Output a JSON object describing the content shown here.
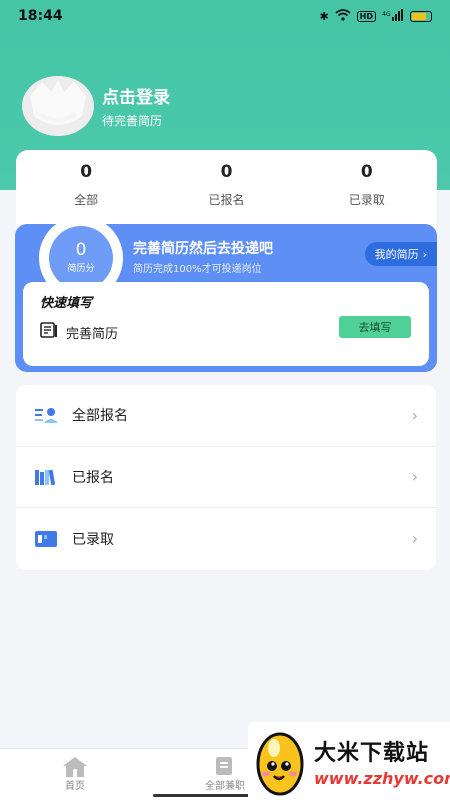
{
  "status_bar": {
    "time": "18:44",
    "signal_text": "4G",
    "hd_badge": "HD"
  },
  "profile": {
    "name": "点击登录",
    "subtitle": "待完善简历"
  },
  "stats": [
    {
      "count": "0",
      "label": "全部"
    },
    {
      "count": "0",
      "label": "已报名"
    },
    {
      "count": "0",
      "label": "已录取"
    }
  ],
  "resume": {
    "score": "0",
    "score_label": "简历分",
    "title": "完善简历然后去投递吧",
    "subtitle": "简历完成100%才可投递岗位",
    "my_resume_button": "我的简历",
    "quick_title": "快速填写",
    "quick_item": "完善简历",
    "fill_button": "去填写"
  },
  "menu": [
    {
      "label": "全部报名",
      "icon": "list-user-icon"
    },
    {
      "label": "已报名",
      "icon": "books-icon"
    },
    {
      "label": "已录取",
      "icon": "card-icon"
    }
  ],
  "tabbar": {
    "home": "首页",
    "all_jobs": "全部兼职"
  },
  "watermark": {
    "title": "大米下载站",
    "url": "www.zzhyw.com"
  },
  "colors": {
    "header": "#45c4a6",
    "resume_card": "#5d8ff5",
    "fill_button": "#4fd096"
  }
}
